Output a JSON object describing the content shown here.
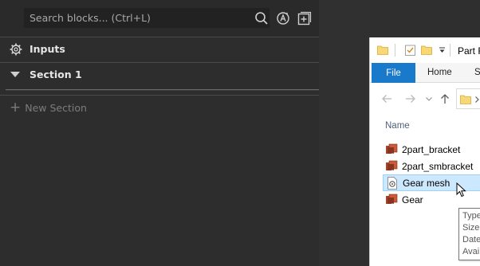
{
  "left_panel": {
    "search": {
      "placeholder": "Search blocks... (Ctrl+L)"
    },
    "inputs_label": "Inputs",
    "section": {
      "label": "Section 1",
      "expanded": true
    },
    "new_section_label": "New Section"
  },
  "explorer": {
    "title_fragment": "Part F",
    "tabs": [
      "File",
      "Home",
      "Sh"
    ],
    "column_header": "Name",
    "files": [
      {
        "name": "2part_bracket",
        "icon": "solid-part-icon",
        "selected": false
      },
      {
        "name": "2part_smbracket",
        "icon": "solid-part-icon",
        "selected": false
      },
      {
        "name": "Gear mesh",
        "icon": "mesh-file-icon",
        "selected": true
      },
      {
        "name": "Gear",
        "icon": "solid-part-icon",
        "selected": false
      }
    ],
    "tooltip_lines": [
      "Type",
      "Size:",
      "Date",
      "Avai"
    ]
  },
  "colors": {
    "panel_bg": "#2d2d2d",
    "accent_blue": "#1979ca",
    "selection_bg": "#cce8ff"
  }
}
